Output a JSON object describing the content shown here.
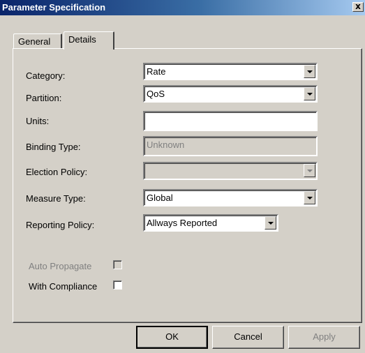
{
  "window": {
    "title": "Parameter Specification",
    "close_glyph": "x"
  },
  "tabs": [
    {
      "label": "General",
      "active": false
    },
    {
      "label": "Details",
      "active": true
    }
  ],
  "form": {
    "category": {
      "label": "Category:",
      "value": "Rate"
    },
    "partition": {
      "label": "Partition:",
      "value": "QoS"
    },
    "units": {
      "label": "Units:",
      "value": ""
    },
    "binding_type": {
      "label": "Binding Type:",
      "value": "Unknown"
    },
    "election_policy": {
      "label": "Election Policy:",
      "value": ""
    },
    "measure_type": {
      "label": "Measure Type:",
      "value": "Global"
    },
    "reporting_policy": {
      "label": "Reporting Policy:",
      "value": "Allways Reported"
    }
  },
  "checkboxes": {
    "auto_propagate": {
      "label": "Auto Propagate",
      "checked": false,
      "enabled": false
    },
    "with_compliance": {
      "label": "With Compliance",
      "checked": false,
      "enabled": true
    }
  },
  "buttons": {
    "ok": "OK",
    "cancel": "Cancel",
    "apply": "Apply"
  },
  "icons": {
    "dropdown": "chevron-down-icon",
    "close": "close-icon"
  }
}
